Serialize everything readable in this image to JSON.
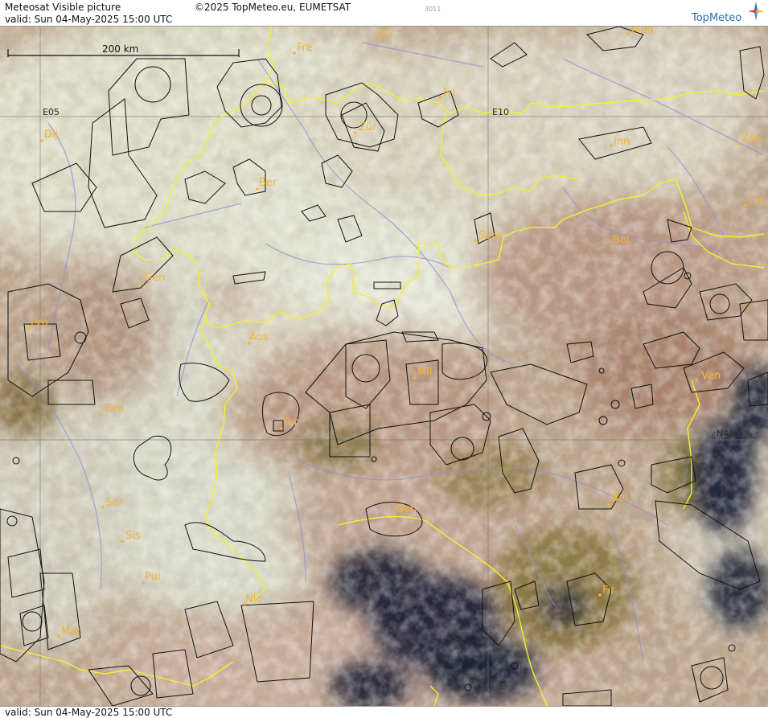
{
  "header": {
    "title": "Meteosat Visible picture",
    "copyright": "©2025 TopMeteo.eu, EUMETSAT",
    "code": "3011",
    "valid": "valid:  Sun  04-May-2025  15:00 UTC",
    "logo_text": "TopMeteo"
  },
  "footer": {
    "valid": "valid:  Sun  04-May-2025  15:00 UTC"
  },
  "map": {
    "scale_label": "200 km",
    "grid_labels": [
      "E05",
      "E10",
      "N45"
    ],
    "cities": [
      "Kil",
      "Mun",
      "Fre",
      "Fri",
      "Dij",
      "Zür",
      "E10",
      "Inn",
      "ZaS",
      "Ber",
      "Lie",
      "Sam",
      "Bol",
      "Gen",
      "Lyo",
      "Aos",
      "Mil",
      "Ven",
      "Gre",
      "Tor",
      "Ser",
      "Bol",
      "Sis",
      "Gen",
      "Pui",
      "Fir",
      "Nic",
      "Mar"
    ]
  },
  "colors": {
    "border": "#f5f02a",
    "river": "#8f8fd8",
    "airspace": "#111111",
    "city": "#f2b437",
    "terrain_brown": "#b08e74",
    "cloud": "#dfe1d0",
    "cloud_shadow": "#1e2130",
    "grid": "#777777"
  },
  "icons": {
    "logo": "compass-star-icon"
  }
}
